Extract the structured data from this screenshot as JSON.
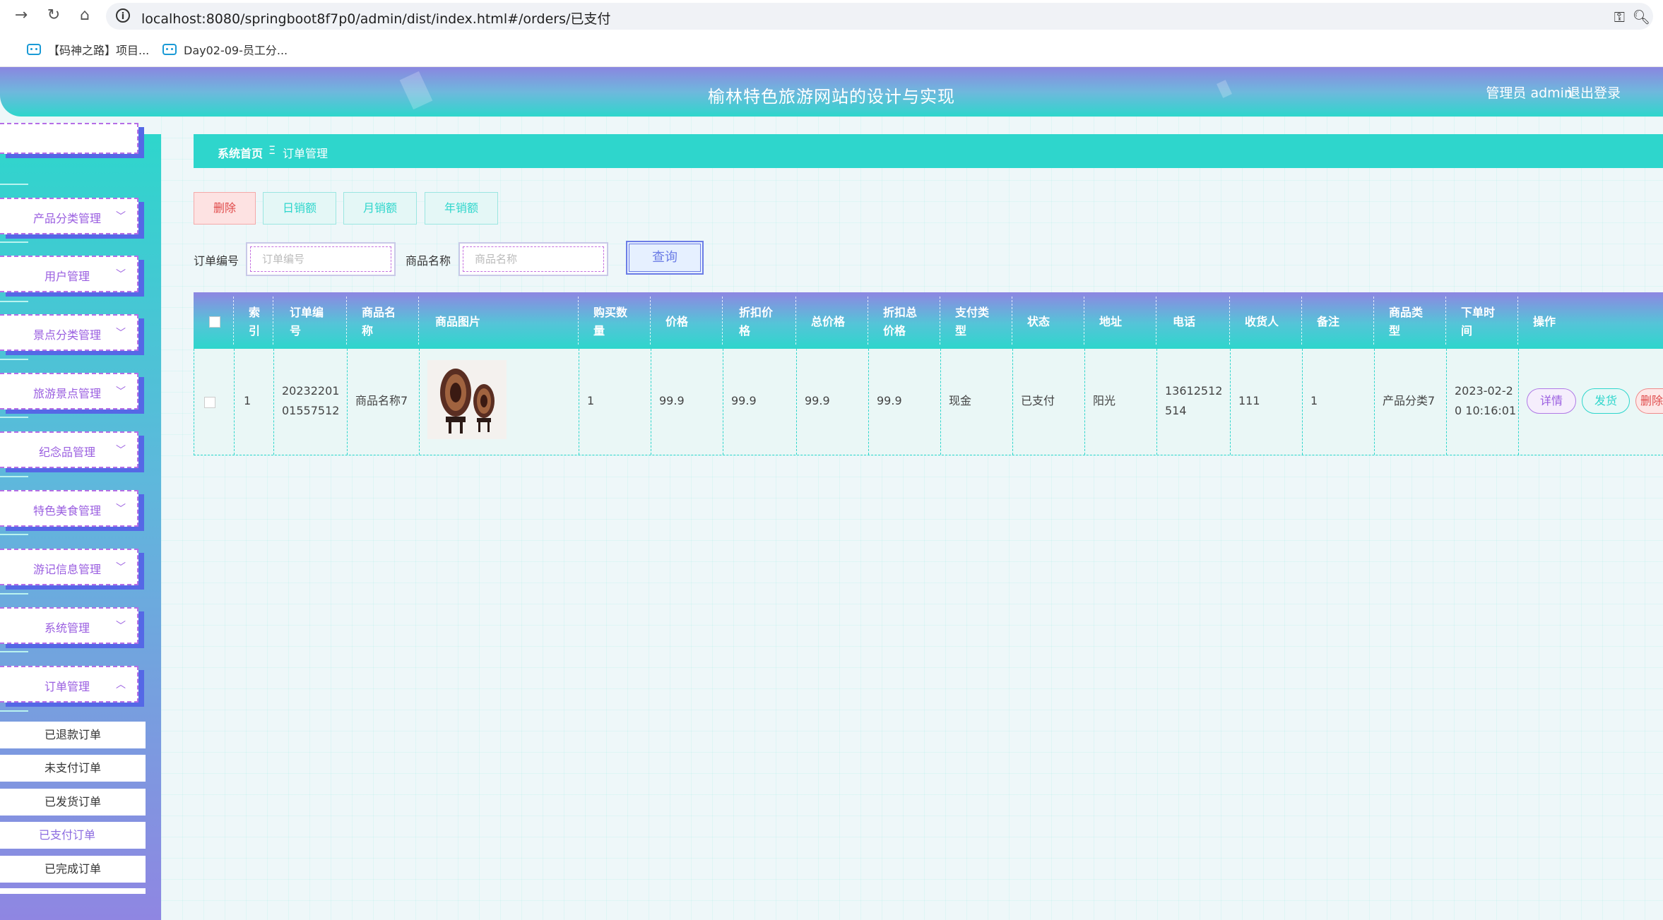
{
  "browser": {
    "url": "localhost:8080/springboot8f7p0/admin/dist/index.html#/orders/已支付",
    "bookmarks": [
      "【码神之路】项目...",
      "Day02-09-员工分..."
    ]
  },
  "header": {
    "title": "榆林特色旅游网站的设计与实现",
    "user": "管理员 admin",
    "logout": "退出登录"
  },
  "sidebar": {
    "items": [
      {
        "label": "产品分类管理"
      },
      {
        "label": "用户管理"
      },
      {
        "label": "景点分类管理"
      },
      {
        "label": "旅游景点管理"
      },
      {
        "label": "纪念品管理"
      },
      {
        "label": "特色美食管理"
      },
      {
        "label": "游记信息管理"
      },
      {
        "label": "系统管理"
      },
      {
        "label": "订单管理"
      }
    ],
    "submenu": [
      "已退款订单",
      "未支付订单",
      "已发货订单",
      "已支付订单",
      "已完成订单"
    ]
  },
  "breadcrumb": {
    "home": "系统首页",
    "separator": "Ξ",
    "current": "订单管理"
  },
  "actions": {
    "delete": "删除",
    "daily": "日销额",
    "monthly": "月销额",
    "yearly": "年销额"
  },
  "search": {
    "order_label": "订单编号",
    "order_placeholder": "订单编号",
    "product_label": "商品名称",
    "product_placeholder": "商品名称",
    "query": "查询"
  },
  "table": {
    "headers": [
      "索\n引",
      "订单编\n号",
      "商品名\n称",
      "商品图片",
      "购买数\n量",
      "价格",
      "折扣价\n格",
      "总价格",
      "折扣总\n价格",
      "支付类\n型",
      "状态",
      "地址",
      "电话",
      "收货人",
      "备注",
      "商品类\n型",
      "下单时\n间",
      "操作"
    ],
    "row": {
      "index": "1",
      "order_no": "20232201\n01557512",
      "product_name": "商品名称7",
      "quantity": "1",
      "price": "99.9",
      "discount_price": "99.9",
      "total": "99.9",
      "discount_total": "99.9",
      "pay_type": "现金",
      "status": "已支付",
      "address": "阳光",
      "phone": "13612512\n514",
      "receiver": "111",
      "remark": "1",
      "product_type": "产品分类7",
      "order_time": "2023-02-2\n0 10:16:01"
    },
    "ops": {
      "detail": "详情",
      "ship": "发货",
      "delete": "删除"
    }
  }
}
